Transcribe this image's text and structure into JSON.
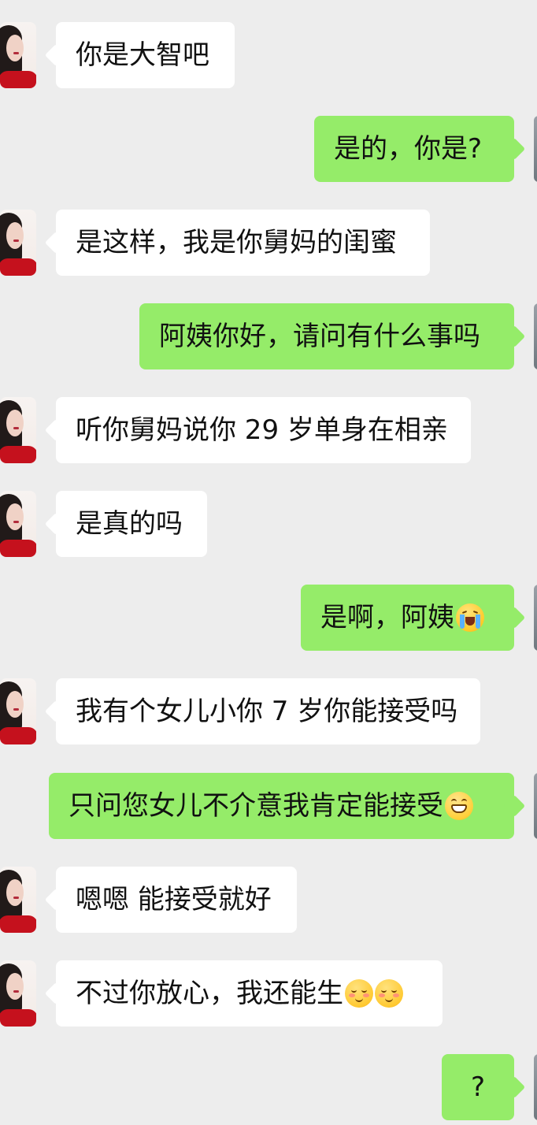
{
  "messages": [
    {
      "text": "你是大智吧"
    },
    {
      "text": "是的，你是?"
    },
    {
      "text": "是这样，我是你舅妈的闺蜜"
    },
    {
      "text": "阿姨你好，请问有什么事吗"
    },
    {
      "text": "听你舅妈说你 29 岁单身在相亲"
    },
    {
      "text": "是真的吗"
    },
    {
      "text": "是啊，阿姨",
      "emoji": "crying-face"
    },
    {
      "text": "我有个女儿小你 7 岁你能接受吗"
    },
    {
      "text": "只问您女儿不介意我肯定能接受",
      "emoji": "grinning-face"
    },
    {
      "text": "嗯嗯 能接受就好"
    },
    {
      "text": "不过你放心，我还能生",
      "emojis": [
        "blushing-face",
        "blushing-face"
      ]
    },
    {
      "text": "?"
    }
  ],
  "colors": {
    "background": "#ededed",
    "incoming_bubble": "#ffffff",
    "outgoing_bubble": "#95ec69",
    "text": "#111111"
  }
}
